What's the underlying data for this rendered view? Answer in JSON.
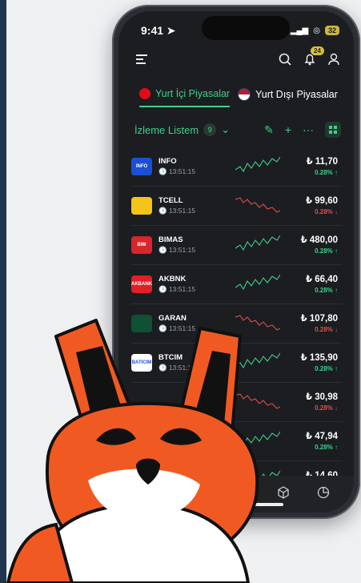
{
  "status": {
    "time": "9:41",
    "battery": "32"
  },
  "header": {
    "notification_count": "24"
  },
  "tabs": [
    {
      "label": "Yurt İçi Piyasalar",
      "active": true
    },
    {
      "label": "Yurt Dışı Piyasalar",
      "active": false
    }
  ],
  "watchlist": {
    "title": "İzleme Listem",
    "count": "9"
  },
  "stocks": [
    {
      "symbol": "INFO",
      "time": "13:51:15",
      "price": "₺ 11,70",
      "change": "0.28% ↑",
      "dir": "up",
      "logo_text": "INFO",
      "logo_color": "#1b4fd8"
    },
    {
      "symbol": "TCELL",
      "time": "13:51:15",
      "price": "₺ 99,60",
      "change": "0.28% ↓",
      "dir": "down",
      "logo_text": "",
      "logo_color": "#f5c418"
    },
    {
      "symbol": "BIMAS",
      "time": "13:51:15",
      "price": "₺ 480,00",
      "change": "0.28% ↑",
      "dir": "up",
      "logo_text": "BIM",
      "logo_color": "#d8262c"
    },
    {
      "symbol": "AKBNK",
      "time": "13:51:15",
      "price": "₺ 66,40",
      "change": "0.28% ↑",
      "dir": "up",
      "logo_text": "AKBANK",
      "logo_color": "#e21f26"
    },
    {
      "symbol": "GARAN",
      "time": "13:51:15",
      "price": "₺ 107,80",
      "change": "0.28% ↓",
      "dir": "down",
      "logo_text": "",
      "logo_color": "#0f5132"
    },
    {
      "symbol": "BTCIM",
      "time": "13:51:15",
      "price": "₺ 135,90",
      "change": "0.28% ↑",
      "dir": "up",
      "logo_text": "BATICIM",
      "logo_color": "#ffffff"
    },
    {
      "symbol": "",
      "time": "",
      "price": "₺ 30,98",
      "change": "0.28% ↓",
      "dir": "down",
      "logo_text": "",
      "logo_color": ""
    },
    {
      "symbol": "",
      "time": "",
      "price": "₺ 47,94",
      "change": "0.28% ↑",
      "dir": "up",
      "logo_text": "",
      "logo_color": ""
    },
    {
      "symbol": "",
      "time": "",
      "price": "₺ 14,60",
      "change": "",
      "dir": "up",
      "logo_text": "",
      "logo_color": ""
    }
  ],
  "colors": {
    "up": "#3fd08b",
    "down": "#e0504d",
    "fox": "#f05a22"
  }
}
